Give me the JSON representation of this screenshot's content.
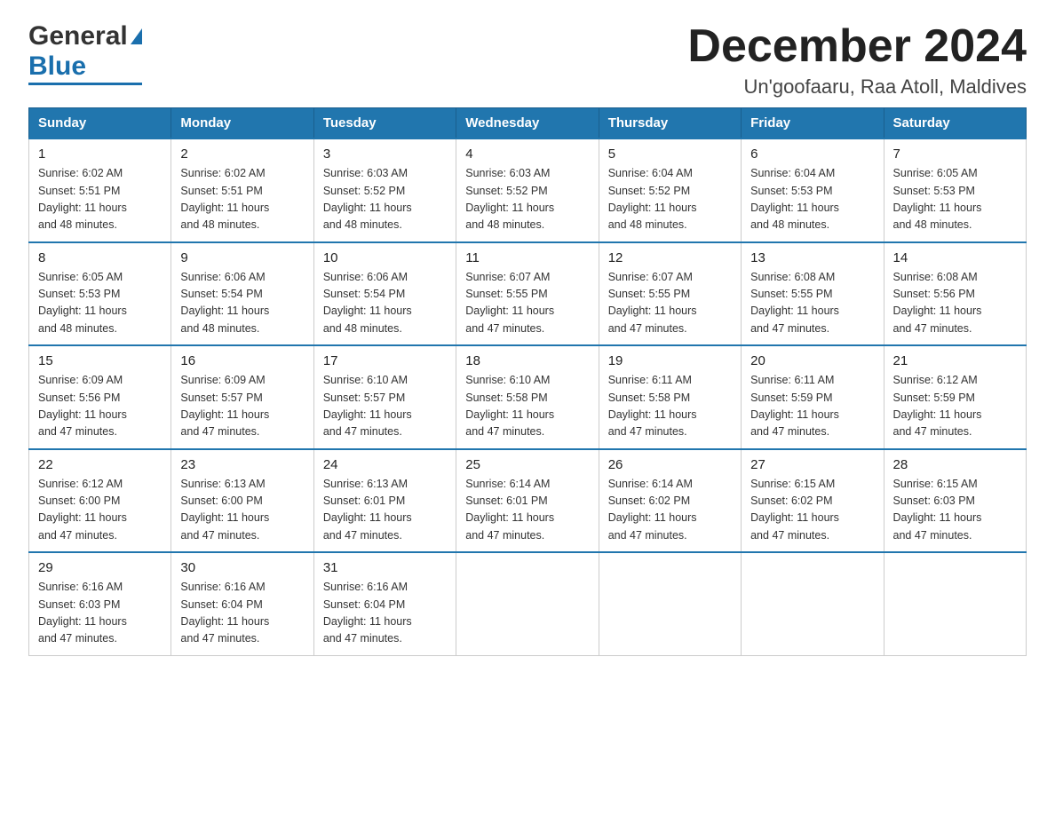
{
  "header": {
    "logo_general": "General",
    "logo_blue": "Blue",
    "month_title": "December 2024",
    "subtitle": "Un'goofaaru, Raa Atoll, Maldives"
  },
  "weekdays": [
    "Sunday",
    "Monday",
    "Tuesday",
    "Wednesday",
    "Thursday",
    "Friday",
    "Saturday"
  ],
  "weeks": [
    [
      {
        "day": "1",
        "sunrise": "6:02 AM",
        "sunset": "5:51 PM",
        "daylight": "11 hours and 48 minutes."
      },
      {
        "day": "2",
        "sunrise": "6:02 AM",
        "sunset": "5:51 PM",
        "daylight": "11 hours and 48 minutes."
      },
      {
        "day": "3",
        "sunrise": "6:03 AM",
        "sunset": "5:52 PM",
        "daylight": "11 hours and 48 minutes."
      },
      {
        "day": "4",
        "sunrise": "6:03 AM",
        "sunset": "5:52 PM",
        "daylight": "11 hours and 48 minutes."
      },
      {
        "day": "5",
        "sunrise": "6:04 AM",
        "sunset": "5:52 PM",
        "daylight": "11 hours and 48 minutes."
      },
      {
        "day": "6",
        "sunrise": "6:04 AM",
        "sunset": "5:53 PM",
        "daylight": "11 hours and 48 minutes."
      },
      {
        "day": "7",
        "sunrise": "6:05 AM",
        "sunset": "5:53 PM",
        "daylight": "11 hours and 48 minutes."
      }
    ],
    [
      {
        "day": "8",
        "sunrise": "6:05 AM",
        "sunset": "5:53 PM",
        "daylight": "11 hours and 48 minutes."
      },
      {
        "day": "9",
        "sunrise": "6:06 AM",
        "sunset": "5:54 PM",
        "daylight": "11 hours and 48 minutes."
      },
      {
        "day": "10",
        "sunrise": "6:06 AM",
        "sunset": "5:54 PM",
        "daylight": "11 hours and 48 minutes."
      },
      {
        "day": "11",
        "sunrise": "6:07 AM",
        "sunset": "5:55 PM",
        "daylight": "11 hours and 47 minutes."
      },
      {
        "day": "12",
        "sunrise": "6:07 AM",
        "sunset": "5:55 PM",
        "daylight": "11 hours and 47 minutes."
      },
      {
        "day": "13",
        "sunrise": "6:08 AM",
        "sunset": "5:55 PM",
        "daylight": "11 hours and 47 minutes."
      },
      {
        "day": "14",
        "sunrise": "6:08 AM",
        "sunset": "5:56 PM",
        "daylight": "11 hours and 47 minutes."
      }
    ],
    [
      {
        "day": "15",
        "sunrise": "6:09 AM",
        "sunset": "5:56 PM",
        "daylight": "11 hours and 47 minutes."
      },
      {
        "day": "16",
        "sunrise": "6:09 AM",
        "sunset": "5:57 PM",
        "daylight": "11 hours and 47 minutes."
      },
      {
        "day": "17",
        "sunrise": "6:10 AM",
        "sunset": "5:57 PM",
        "daylight": "11 hours and 47 minutes."
      },
      {
        "day": "18",
        "sunrise": "6:10 AM",
        "sunset": "5:58 PM",
        "daylight": "11 hours and 47 minutes."
      },
      {
        "day": "19",
        "sunrise": "6:11 AM",
        "sunset": "5:58 PM",
        "daylight": "11 hours and 47 minutes."
      },
      {
        "day": "20",
        "sunrise": "6:11 AM",
        "sunset": "5:59 PM",
        "daylight": "11 hours and 47 minutes."
      },
      {
        "day": "21",
        "sunrise": "6:12 AM",
        "sunset": "5:59 PM",
        "daylight": "11 hours and 47 minutes."
      }
    ],
    [
      {
        "day": "22",
        "sunrise": "6:12 AM",
        "sunset": "6:00 PM",
        "daylight": "11 hours and 47 minutes."
      },
      {
        "day": "23",
        "sunrise": "6:13 AM",
        "sunset": "6:00 PM",
        "daylight": "11 hours and 47 minutes."
      },
      {
        "day": "24",
        "sunrise": "6:13 AM",
        "sunset": "6:01 PM",
        "daylight": "11 hours and 47 minutes."
      },
      {
        "day": "25",
        "sunrise": "6:14 AM",
        "sunset": "6:01 PM",
        "daylight": "11 hours and 47 minutes."
      },
      {
        "day": "26",
        "sunrise": "6:14 AM",
        "sunset": "6:02 PM",
        "daylight": "11 hours and 47 minutes."
      },
      {
        "day": "27",
        "sunrise": "6:15 AM",
        "sunset": "6:02 PM",
        "daylight": "11 hours and 47 minutes."
      },
      {
        "day": "28",
        "sunrise": "6:15 AM",
        "sunset": "6:03 PM",
        "daylight": "11 hours and 47 minutes."
      }
    ],
    [
      {
        "day": "29",
        "sunrise": "6:16 AM",
        "sunset": "6:03 PM",
        "daylight": "11 hours and 47 minutes."
      },
      {
        "day": "30",
        "sunrise": "6:16 AM",
        "sunset": "6:04 PM",
        "daylight": "11 hours and 47 minutes."
      },
      {
        "day": "31",
        "sunrise": "6:16 AM",
        "sunset": "6:04 PM",
        "daylight": "11 hours and 47 minutes."
      },
      null,
      null,
      null,
      null
    ]
  ],
  "labels": {
    "sunrise": "Sunrise:",
    "sunset": "Sunset:",
    "daylight": "Daylight:"
  }
}
